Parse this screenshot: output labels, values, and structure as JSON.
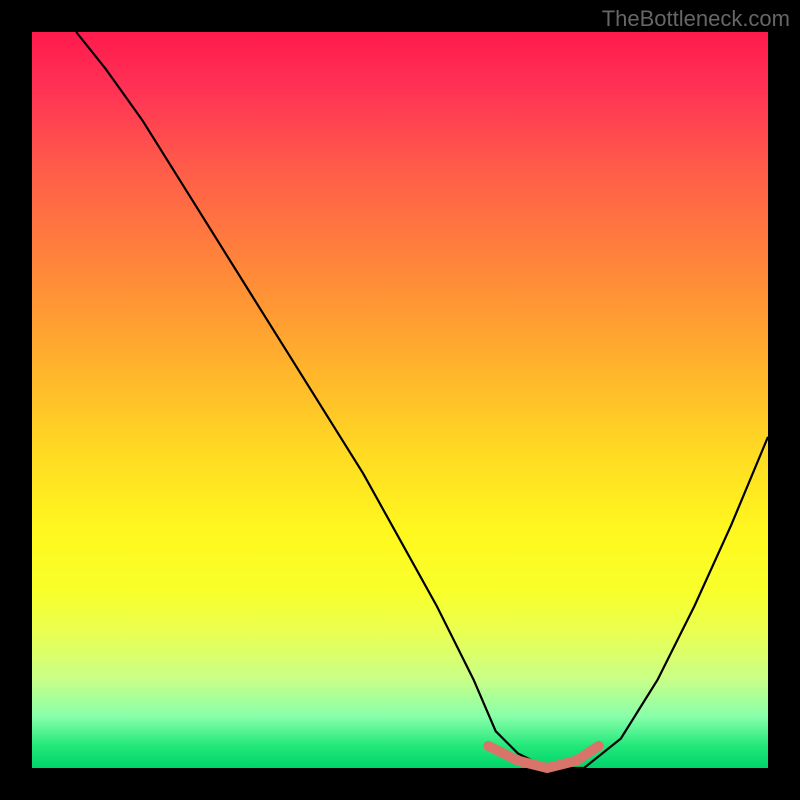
{
  "watermark": "TheBottleneck.com",
  "chart_data": {
    "type": "line",
    "title": "",
    "xlabel": "",
    "ylabel": "",
    "xlim": [
      0,
      100
    ],
    "ylim": [
      0,
      100
    ],
    "series": [
      {
        "name": "bottleneck-curve",
        "x": [
          6,
          10,
          15,
          20,
          25,
          30,
          35,
          40,
          45,
          50,
          55,
          60,
          63,
          66,
          70,
          75,
          80,
          85,
          90,
          95,
          100
        ],
        "y": [
          100,
          95,
          88,
          80,
          72,
          64,
          56,
          48,
          40,
          31,
          22,
          12,
          5,
          2,
          0,
          0,
          4,
          12,
          22,
          33,
          45
        ]
      }
    ],
    "marker": {
      "name": "optimal-range",
      "x": [
        62,
        66,
        70,
        74,
        77
      ],
      "y": [
        3,
        1,
        0,
        1,
        3
      ]
    },
    "background_gradient": {
      "top": "#ff1a4d",
      "mid": "#ffdd22",
      "bottom": "#00d46a"
    }
  }
}
